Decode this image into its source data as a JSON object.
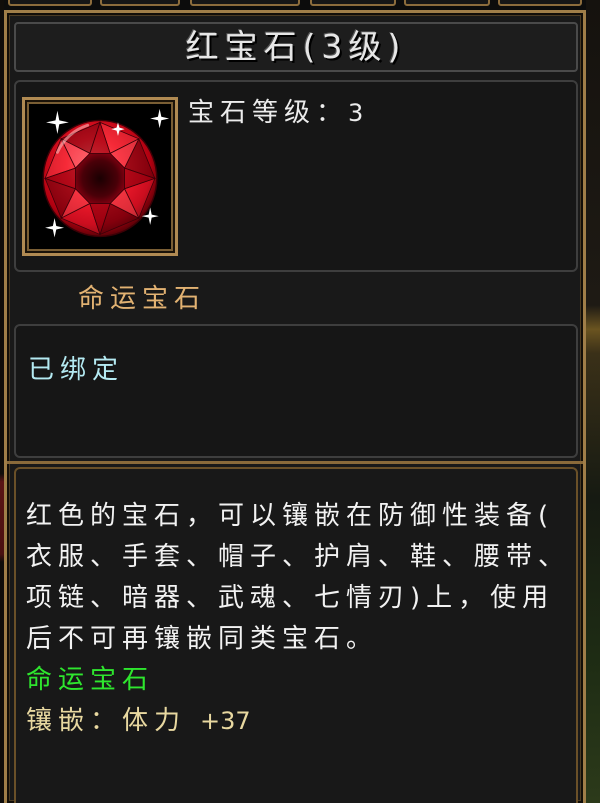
{
  "title": "红宝石(3级)",
  "item": {
    "icon": "red-gem-icon",
    "level_label": "宝石等级：",
    "level_value": "3"
  },
  "category": "命运宝石",
  "binding_status": "已绑定",
  "description": {
    "lines": [
      "红色的宝石，可以镶嵌在防御性装备(",
      "衣服、手套、帽子、护肩、鞋、腰带、",
      "项链、暗器、武魂、七情刃)上，使用",
      "后不可再镶嵌同类宝石。"
    ],
    "set_name": "命运宝石",
    "inlay": {
      "label": "镶嵌：",
      "attribute": "体力",
      "value": "+37"
    }
  },
  "colors": {
    "panel_border": "#a07e48",
    "title_text": "#e6e6e6",
    "level_text": "#ececec",
    "category_text": "#e2b272",
    "bound_text": "#b4eaf2",
    "description_text": "#f2f2f2",
    "set_name_text": "#2ee62e",
    "inlay_text": "#e8d8a0",
    "icon_frame": "#b08a52"
  }
}
